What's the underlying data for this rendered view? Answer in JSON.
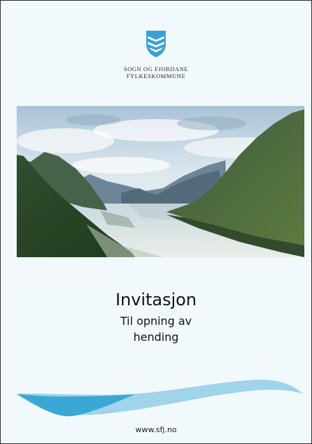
{
  "logo": {
    "icon": "county-coat-of-arms-icon",
    "org_line1": "SOGN OG FJORDANE",
    "org_line2": "FYLKESKOMMUNE"
  },
  "cover_image": {
    "subject": "fjord-landscape-photo"
  },
  "invitation": {
    "title": "Invitasjon",
    "subtitle_line1": "Til opning av",
    "subtitle_line2": "hending"
  },
  "footer": {
    "url": "www.sfj.no"
  },
  "colors": {
    "background": "#f2f9fc",
    "border": "#2b2b2b",
    "logo_blue": "#3aa0d8",
    "wave_dark": "#3aa7d6",
    "wave_light": "#9fd4ea"
  }
}
